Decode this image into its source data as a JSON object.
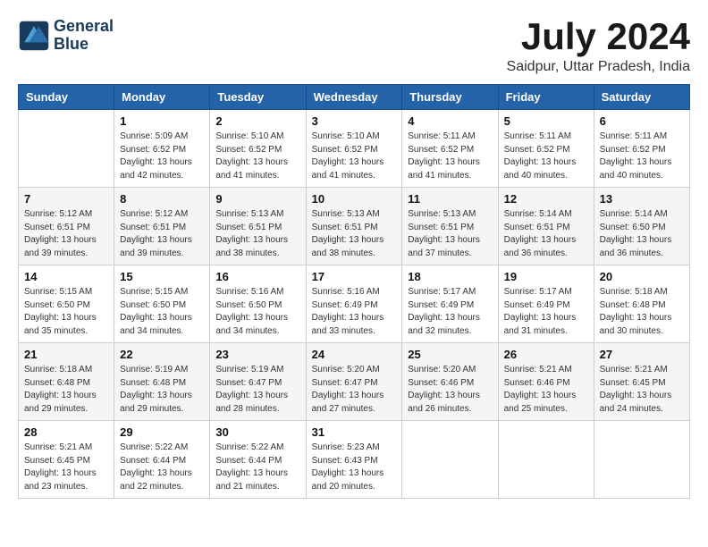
{
  "header": {
    "logo_line1": "General",
    "logo_line2": "Blue",
    "month_year": "July 2024",
    "location": "Saidpur, Uttar Pradesh, India"
  },
  "weekdays": [
    "Sunday",
    "Monday",
    "Tuesday",
    "Wednesday",
    "Thursday",
    "Friday",
    "Saturday"
  ],
  "weeks": [
    [
      {
        "day": "",
        "info": ""
      },
      {
        "day": "1",
        "info": "Sunrise: 5:09 AM\nSunset: 6:52 PM\nDaylight: 13 hours\nand 42 minutes."
      },
      {
        "day": "2",
        "info": "Sunrise: 5:10 AM\nSunset: 6:52 PM\nDaylight: 13 hours\nand 41 minutes."
      },
      {
        "day": "3",
        "info": "Sunrise: 5:10 AM\nSunset: 6:52 PM\nDaylight: 13 hours\nand 41 minutes."
      },
      {
        "day": "4",
        "info": "Sunrise: 5:11 AM\nSunset: 6:52 PM\nDaylight: 13 hours\nand 41 minutes."
      },
      {
        "day": "5",
        "info": "Sunrise: 5:11 AM\nSunset: 6:52 PM\nDaylight: 13 hours\nand 40 minutes."
      },
      {
        "day": "6",
        "info": "Sunrise: 5:11 AM\nSunset: 6:52 PM\nDaylight: 13 hours\nand 40 minutes."
      }
    ],
    [
      {
        "day": "7",
        "info": "Sunrise: 5:12 AM\nSunset: 6:51 PM\nDaylight: 13 hours\nand 39 minutes."
      },
      {
        "day": "8",
        "info": "Sunrise: 5:12 AM\nSunset: 6:51 PM\nDaylight: 13 hours\nand 39 minutes."
      },
      {
        "day": "9",
        "info": "Sunrise: 5:13 AM\nSunset: 6:51 PM\nDaylight: 13 hours\nand 38 minutes."
      },
      {
        "day": "10",
        "info": "Sunrise: 5:13 AM\nSunset: 6:51 PM\nDaylight: 13 hours\nand 38 minutes."
      },
      {
        "day": "11",
        "info": "Sunrise: 5:13 AM\nSunset: 6:51 PM\nDaylight: 13 hours\nand 37 minutes."
      },
      {
        "day": "12",
        "info": "Sunrise: 5:14 AM\nSunset: 6:51 PM\nDaylight: 13 hours\nand 36 minutes."
      },
      {
        "day": "13",
        "info": "Sunrise: 5:14 AM\nSunset: 6:50 PM\nDaylight: 13 hours\nand 36 minutes."
      }
    ],
    [
      {
        "day": "14",
        "info": "Sunrise: 5:15 AM\nSunset: 6:50 PM\nDaylight: 13 hours\nand 35 minutes."
      },
      {
        "day": "15",
        "info": "Sunrise: 5:15 AM\nSunset: 6:50 PM\nDaylight: 13 hours\nand 34 minutes."
      },
      {
        "day": "16",
        "info": "Sunrise: 5:16 AM\nSunset: 6:50 PM\nDaylight: 13 hours\nand 34 minutes."
      },
      {
        "day": "17",
        "info": "Sunrise: 5:16 AM\nSunset: 6:49 PM\nDaylight: 13 hours\nand 33 minutes."
      },
      {
        "day": "18",
        "info": "Sunrise: 5:17 AM\nSunset: 6:49 PM\nDaylight: 13 hours\nand 32 minutes."
      },
      {
        "day": "19",
        "info": "Sunrise: 5:17 AM\nSunset: 6:49 PM\nDaylight: 13 hours\nand 31 minutes."
      },
      {
        "day": "20",
        "info": "Sunrise: 5:18 AM\nSunset: 6:48 PM\nDaylight: 13 hours\nand 30 minutes."
      }
    ],
    [
      {
        "day": "21",
        "info": "Sunrise: 5:18 AM\nSunset: 6:48 PM\nDaylight: 13 hours\nand 29 minutes."
      },
      {
        "day": "22",
        "info": "Sunrise: 5:19 AM\nSunset: 6:48 PM\nDaylight: 13 hours\nand 29 minutes."
      },
      {
        "day": "23",
        "info": "Sunrise: 5:19 AM\nSunset: 6:47 PM\nDaylight: 13 hours\nand 28 minutes."
      },
      {
        "day": "24",
        "info": "Sunrise: 5:20 AM\nSunset: 6:47 PM\nDaylight: 13 hours\nand 27 minutes."
      },
      {
        "day": "25",
        "info": "Sunrise: 5:20 AM\nSunset: 6:46 PM\nDaylight: 13 hours\nand 26 minutes."
      },
      {
        "day": "26",
        "info": "Sunrise: 5:21 AM\nSunset: 6:46 PM\nDaylight: 13 hours\nand 25 minutes."
      },
      {
        "day": "27",
        "info": "Sunrise: 5:21 AM\nSunset: 6:45 PM\nDaylight: 13 hours\nand 24 minutes."
      }
    ],
    [
      {
        "day": "28",
        "info": "Sunrise: 5:21 AM\nSunset: 6:45 PM\nDaylight: 13 hours\nand 23 minutes."
      },
      {
        "day": "29",
        "info": "Sunrise: 5:22 AM\nSunset: 6:44 PM\nDaylight: 13 hours\nand 22 minutes."
      },
      {
        "day": "30",
        "info": "Sunrise: 5:22 AM\nSunset: 6:44 PM\nDaylight: 13 hours\nand 21 minutes."
      },
      {
        "day": "31",
        "info": "Sunrise: 5:23 AM\nSunset: 6:43 PM\nDaylight: 13 hours\nand 20 minutes."
      },
      {
        "day": "",
        "info": ""
      },
      {
        "day": "",
        "info": ""
      },
      {
        "day": "",
        "info": ""
      }
    ]
  ]
}
